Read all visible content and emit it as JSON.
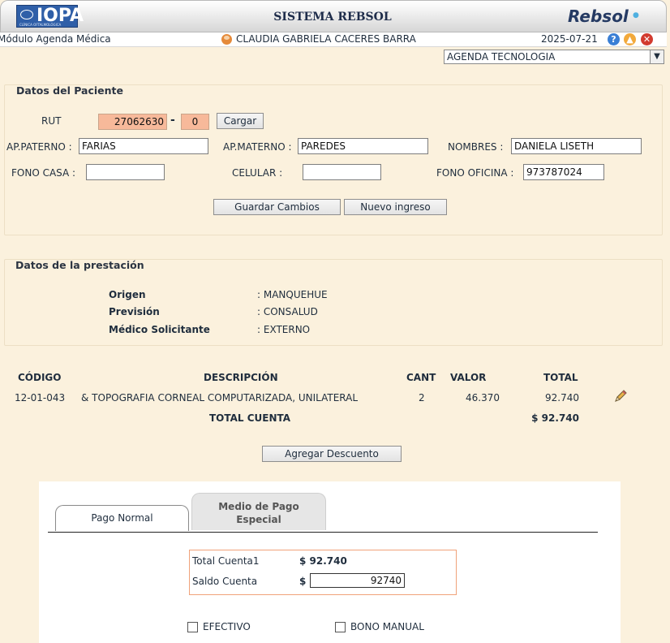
{
  "header": {
    "logo_text": "IOPA",
    "logo_sub": "CLÍNICA OFTALMOLÓGICA",
    "system_title": "SISTEMA REBSOL",
    "brand": "Rebsol"
  },
  "infobar": {
    "module": "Módulo Agenda Médica",
    "user": "CLAUDIA GABRIELA CACERES BARRA",
    "date": "2025-07-21"
  },
  "agenda": {
    "selected": "AGENDA TECNOLOGIA"
  },
  "patient": {
    "section_title": "Datos del Paciente",
    "rut_label": "RUT",
    "rut_value": "27062630",
    "rut_dash": "-",
    "rut_dv": "0",
    "load_button": "Cargar",
    "ap_paterno_label": "AP.PATERNO :",
    "ap_paterno": "FARIAS",
    "ap_materno_label": "AP.MATERNO :",
    "ap_materno": "PAREDES",
    "nombres_label": "NOMBRES :",
    "nombres": "DANIELA LISETH",
    "fono_casa_label": "FONO CASA :",
    "fono_casa": "",
    "celular_label": "CELULAR :",
    "celular": "",
    "fono_oficina_label": "FONO OFICINA :",
    "fono_oficina": "973787024",
    "save_button": "Guardar Cambios",
    "new_button": "Nuevo ingreso"
  },
  "prestacion": {
    "section_title": "Datos de la prestación",
    "rows": [
      {
        "label": "Origen",
        "value": ": MANQUEHUE"
      },
      {
        "label": "Previsión",
        "value": ": CONSALUD"
      },
      {
        "label": "Médico Solicitante",
        "value": ": EXTERNO"
      }
    ]
  },
  "items": {
    "headers": {
      "codigo": "CÓDIGO",
      "descripcion": "DESCRIPCIÓN",
      "cant": "CANT",
      "valor": "VALOR",
      "total": "TOTAL"
    },
    "rows": [
      {
        "codigo": "12-01-043",
        "descripcion": "& TOPOGRAFIA CORNEAL COMPUTARIZADA, UNILATERAL",
        "cant": "2",
        "valor": "46.370",
        "total": "92.740"
      }
    ],
    "total_label": "TOTAL CUENTA",
    "total_value": "$ 92.740",
    "discount_button": "Agregar Descuento"
  },
  "payment": {
    "tabs": [
      {
        "label": "Pago Normal"
      },
      {
        "label_line1": "Medio de Pago",
        "label_line2": "Especial"
      }
    ],
    "total_cuenta_label": "Total Cuenta1",
    "total_cuenta_value": "$ 92.740",
    "saldo_label": "Saldo Cuenta",
    "saldo_currency": "$",
    "saldo_value": "92740",
    "options": [
      {
        "label": "EFECTIVO"
      },
      {
        "label": "BONO MANUAL"
      }
    ]
  }
}
